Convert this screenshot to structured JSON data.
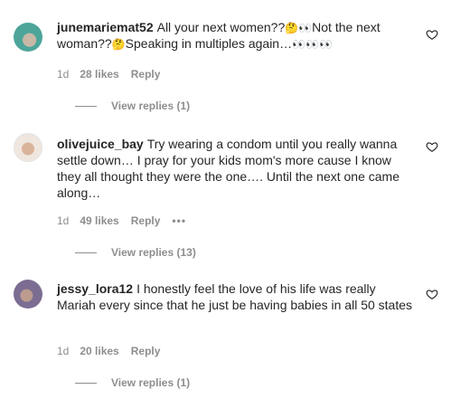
{
  "comments": [
    {
      "username": "junemariemat52",
      "text_1": "All your next women??",
      "emoji_1": "🤔👀",
      "text_2": "Not the next woman??",
      "emoji_2": "🤔",
      "text_3": "Speaking in multiples again…",
      "emoji_3": "👀👀👀",
      "date": "1d",
      "likes": "28 likes",
      "reply": "Reply",
      "view_replies": "View replies (1)"
    },
    {
      "username": "olivejuice_bay",
      "text": "Try wearing a condom until you really wanna settle down… I pray for your kids mom's more cause I know they all thought they were the one…. Until the next one came along…",
      "date": "1d",
      "likes": "49 likes",
      "reply": "Reply",
      "more": "•••",
      "view_replies": "View replies (13)"
    },
    {
      "username": "jessy_lora12",
      "text": "I honestly feel the love of his life was really Mariah every since that he just be having babies in all 50 states",
      "date": "1d",
      "likes": "20 likes",
      "reply": "Reply",
      "view_replies": "View replies (1)"
    }
  ],
  "icons": {
    "like": "heart-icon",
    "more": "more-options-icon"
  },
  "colors": {
    "text": "#262626",
    "secondary": "#8e8e8e",
    "background": "#ffffff"
  }
}
